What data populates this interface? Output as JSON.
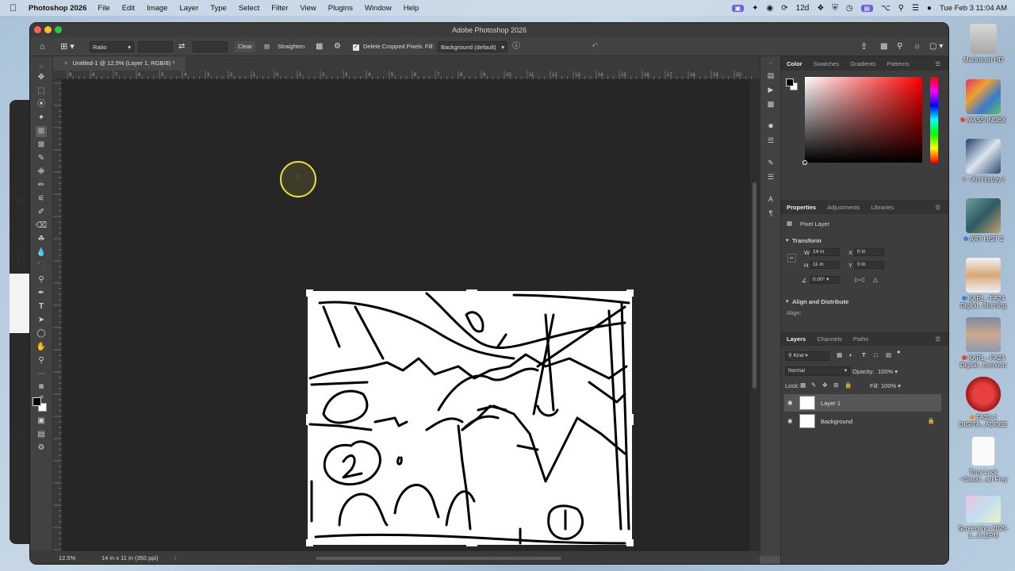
{
  "menubar": {
    "app_name": "Photoshop 2026",
    "menus": [
      "File",
      "Edit",
      "Image",
      "Layer",
      "Type",
      "Select",
      "Filter",
      "View",
      "Plugins",
      "Window",
      "Help"
    ],
    "days_badge": "12d",
    "datetime": "Tue Feb 3  11:04 AM"
  },
  "window": {
    "title": "Adobe Photoshop 2026",
    "doc_tab": "Untitled-1 @ 12.5% (Layer 1, RGB/8) *"
  },
  "options": {
    "ratio_select": "Ratio",
    "clear_label": "Clear",
    "straighten_label": "Straighten",
    "delete_cropped_label": "Delete Cropped Pixels",
    "delete_cropped_checked": true,
    "fill_label": "Fill:",
    "fill_value": "Background (default)"
  },
  "ruler": {
    "top_ticks": [
      "9",
      "8",
      "7",
      "6",
      "5",
      "4",
      "3",
      "2",
      "1",
      "0",
      "1",
      "2",
      "3",
      "4",
      "5",
      "6",
      "7",
      "8",
      "9",
      "10",
      "11",
      "12",
      "13",
      "14",
      "15",
      "16",
      "17",
      "18",
      "19",
      "20"
    ]
  },
  "status": {
    "zoom": "12.5%",
    "doc_info": "14 in x 11 in (350 ppi)"
  },
  "color_panel": {
    "tabs": [
      "Color",
      "Swatches",
      "Gradients",
      "Patterns"
    ],
    "active": "Color"
  },
  "properties_panel": {
    "tabs": [
      "Properties",
      "Adjustments",
      "Libraries"
    ],
    "layer_type": "Pixel Layer",
    "transform_title": "Transform",
    "w_label": "W",
    "w_value": "14 in",
    "h_label": "H",
    "h_value": "11 in",
    "x_label": "X",
    "x_value": "0 in",
    "y_label": "Y",
    "y_value": "0 in",
    "angle_value": "0.00°",
    "align_title": "Align and Distribute",
    "align_label": "Align:"
  },
  "layers_panel": {
    "tabs": [
      "Layers",
      "Channels",
      "Paths"
    ],
    "kind_label": "Kind",
    "blend_mode": "Normal",
    "opacity_label": "Opacity:",
    "opacity_value": "100%",
    "lock_label": "Lock:",
    "fill_label": "Fill:",
    "fill_value": "100%",
    "layers": [
      {
        "name": "Layer 1",
        "selected": true
      },
      {
        "name": "Background",
        "selected": false
      }
    ]
  },
  "desktop_icons": [
    {
      "label": "Macintosh HD",
      "dot": ""
    },
    {
      "label": "MASS INDEX",
      "dot": "#e0443a"
    },
    {
      "label": "~Art History I",
      "dot": "#9a9a9a"
    },
    {
      "label": "ART HIST 2",
      "dot": "#3f7fe0"
    },
    {
      "label": "KARL - FA24 Digital...Morning",
      "dot": "#3f7fe0"
    },
    {
      "label": "KARL - FA24 Digital...fternoon",
      "dot": "#e0443a"
    },
    {
      "label": "FA23-1 DIGITA...ADOBE",
      "dot": "#f08a2a"
    },
    {
      "label": "Tony Lack ~Classr...arl Frey",
      "dot": ""
    },
    {
      "label": "Screenshot 2025-1...3.11PM",
      "dot": ""
    }
  ],
  "colors": {
    "accent_purple": "#6b5fd6",
    "cursor_ring": "#e8e035",
    "panel_bg": "#3d3d3d"
  }
}
